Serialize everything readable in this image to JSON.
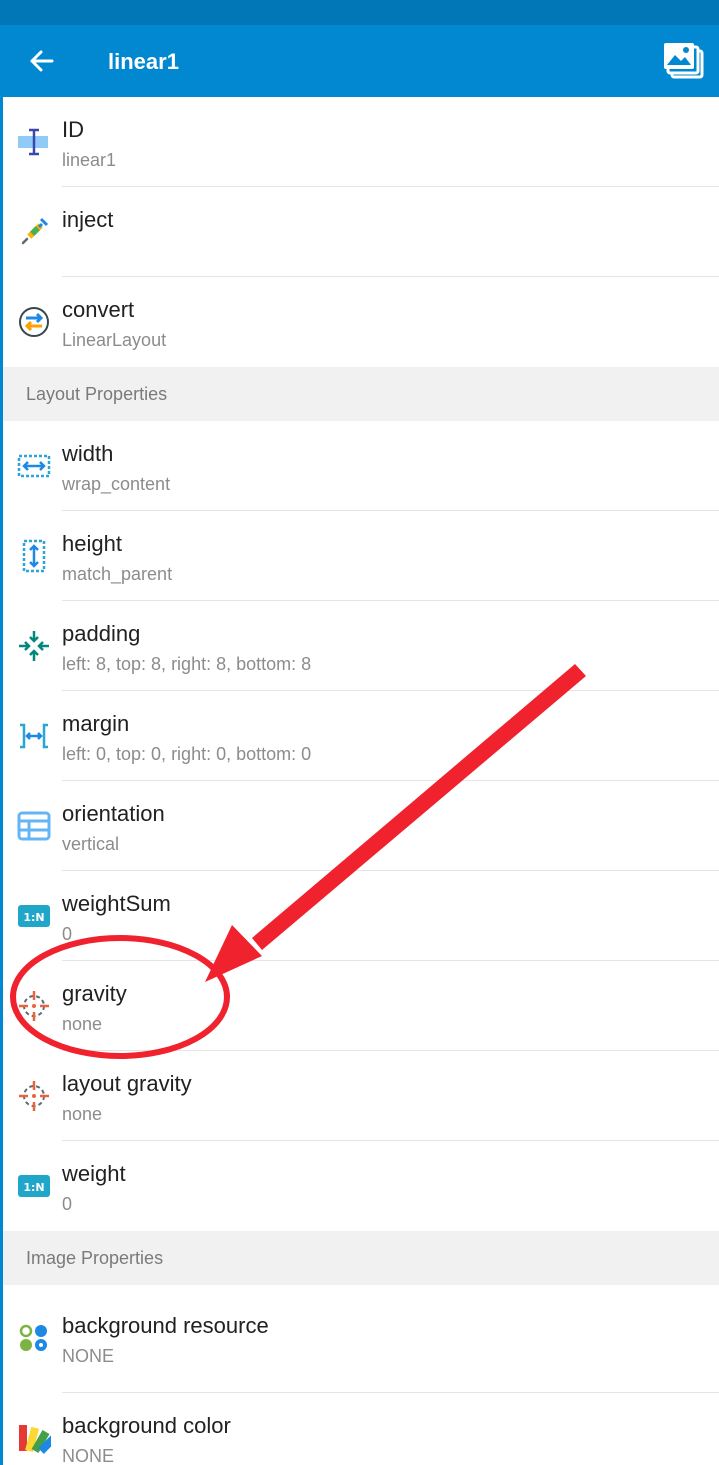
{
  "app_bar": {
    "title": "linear1",
    "back_icon": "arrow-left-icon",
    "gallery_icon": "image-stack-icon"
  },
  "colors": {
    "status_bar": "#0277b7",
    "app_bar": "#0288d1",
    "annotation_red": "#f0222e"
  },
  "rows_top": [
    {
      "label": "ID",
      "value": "linear1",
      "icon": "id-field-icon"
    },
    {
      "label": "inject",
      "value": "",
      "icon": "syringe-icon"
    },
    {
      "label": "convert",
      "value": "LinearLayout",
      "icon": "convert-arrows-icon"
    }
  ],
  "section_layout": "Layout Properties",
  "rows_layout": [
    {
      "label": "width",
      "value": "wrap_content",
      "icon": "width-arrows-icon"
    },
    {
      "label": "height",
      "value": "match_parent",
      "icon": "height-arrows-icon"
    },
    {
      "label": "padding",
      "value": "left: 8, top: 8, right: 8, bottom: 8",
      "icon": "padding-arrows-icon"
    },
    {
      "label": "margin",
      "value": "left: 0, top: 0, right: 0, bottom: 0",
      "icon": "margin-brackets-icon"
    },
    {
      "label": "orientation",
      "value": "vertical",
      "icon": "table-grid-icon"
    },
    {
      "label": "weightSum",
      "value": "0",
      "icon": "ratio-1n-icon"
    },
    {
      "label": "gravity",
      "value": "none",
      "icon": "crosshair-icon"
    },
    {
      "label": "layout gravity",
      "value": "none",
      "icon": "crosshair-icon"
    },
    {
      "label": "weight",
      "value": "0",
      "icon": "ratio-1n-icon"
    }
  ],
  "section_image": "Image Properties",
  "rows_image": [
    {
      "label": "background resource",
      "value": "NONE",
      "icon": "dots-palette-icon"
    },
    {
      "label": "background color",
      "value": "NONE",
      "icon": "color-swatches-icon"
    }
  ],
  "ratio_icon_text": "1:N"
}
